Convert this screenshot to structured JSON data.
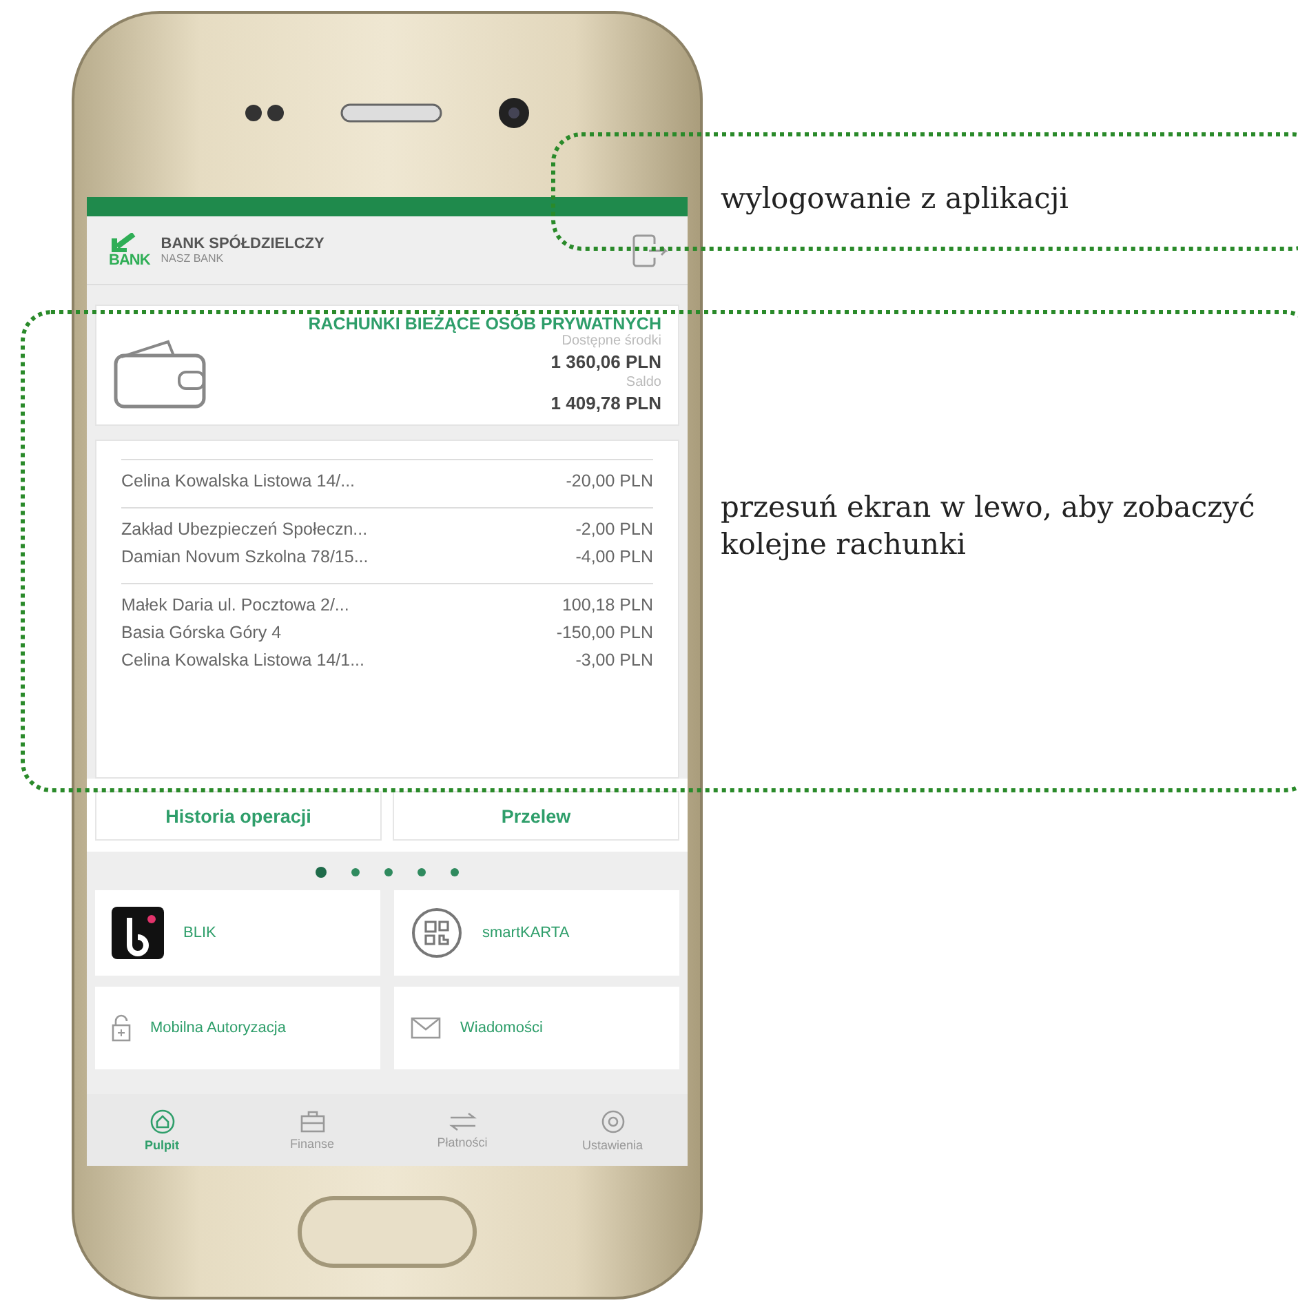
{
  "header": {
    "bank_name": "BANK SPÓŁDZIELCZY",
    "bank_subtitle": "NASZ BANK",
    "logo_text": "BANK"
  },
  "account": {
    "title": "RACHUNKI BIEŻĄCE OSÓB PRYWATNYCH",
    "available_label": "Dostępne środki",
    "available": "1 360,06 PLN",
    "balance_label": "Saldo",
    "balance": "1 409,78 PLN"
  },
  "transaction_groups": [
    {
      "rows": [
        {
          "name": "Celina Kowalska Listowa 14/...",
          "amount": "-20,00 PLN"
        }
      ]
    },
    {
      "rows": [
        {
          "name": "Zakład Ubezpieczeń Społeczn...",
          "amount": "-2,00 PLN"
        },
        {
          "name": "Damian Novum Szkolna 78/15...",
          "amount": "-4,00 PLN"
        }
      ]
    },
    {
      "rows": [
        {
          "name": "Małek Daria  ul. Pocztowa 2/...",
          "amount": "100,18 PLN"
        },
        {
          "name": "Basia Górska Góry 4",
          "amount": "-150,00 PLN"
        },
        {
          "name": "Celina Kowalska Listowa 14/1...",
          "amount": "-3,00 PLN"
        }
      ]
    }
  ],
  "actions": [
    "Historia operacji",
    "Przelew"
  ],
  "pager": [
    {
      "selected": true
    },
    {
      "selected": false
    },
    {
      "selected": false
    },
    {
      "selected": false
    },
    {
      "selected": false
    }
  ],
  "tiles": [
    {
      "kind": "blik",
      "label": "BLIK"
    },
    {
      "kind": "qr",
      "label": "smartKARTA"
    },
    {
      "kind": "lock",
      "label": "Mobilna Autoryzacja"
    },
    {
      "kind": "mail",
      "label": "Wiadomości"
    }
  ],
  "nav": [
    {
      "kind": "home",
      "label": "Pulpit",
      "selected": true
    },
    {
      "kind": "wallet",
      "label": "Finanse",
      "selected": false
    },
    {
      "kind": "transfer",
      "label": "Płatności",
      "selected": false
    },
    {
      "kind": "gear",
      "label": "Ustawienia",
      "selected": false
    }
  ],
  "callouts": [
    {
      "text": "wylogowanie z aplikacji"
    },
    {
      "text": "przesuń ekran w lewo, aby zobaczyć kolejne rachunki"
    }
  ]
}
